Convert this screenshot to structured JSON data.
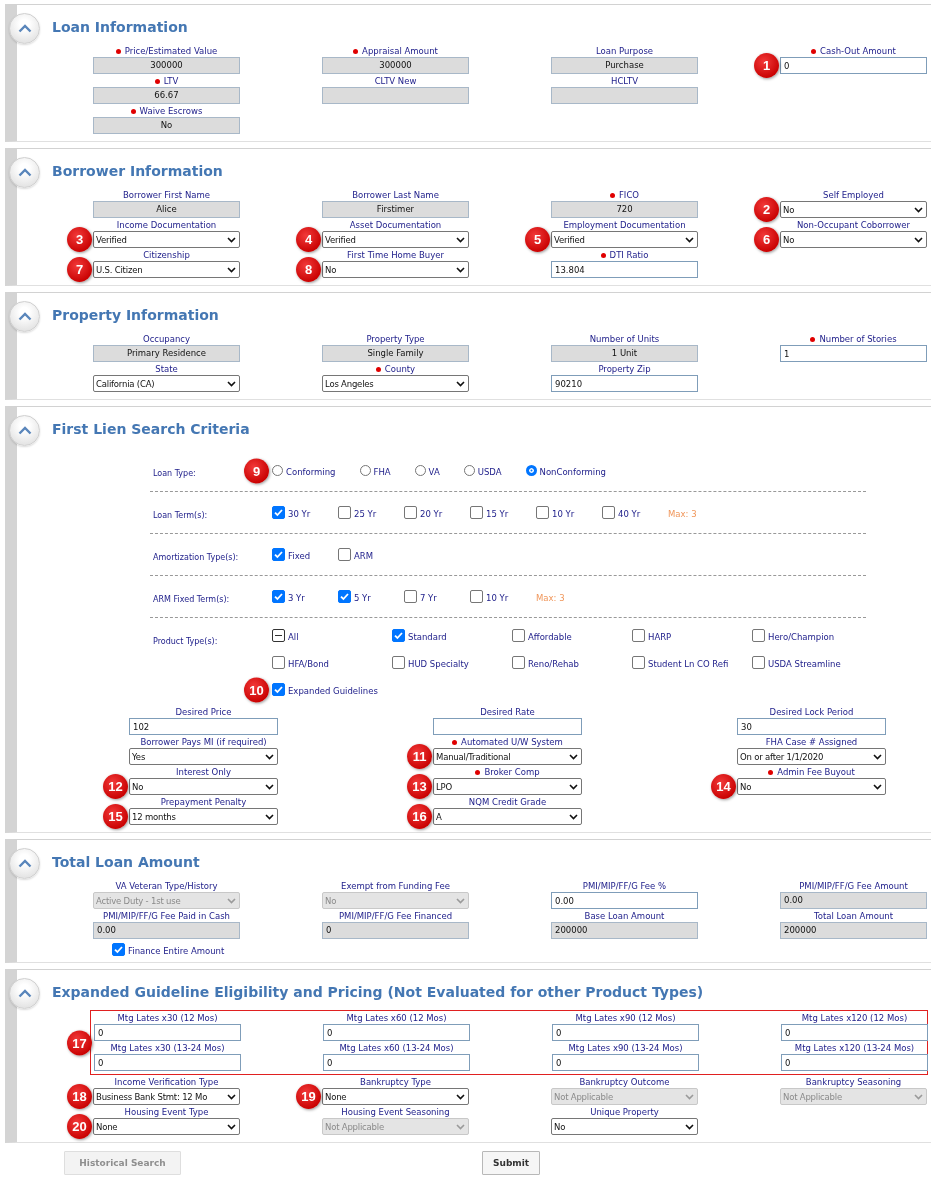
{
  "sections": [
    {
      "title": "Loan Information",
      "kind": "fields",
      "rows": [
        [
          {
            "label": "Price/Estimated Value",
            "required": true,
            "kind": "display",
            "value": "300000"
          },
          {
            "label": "Appraisal Amount",
            "required": true,
            "kind": "display",
            "value": "300000"
          },
          {
            "label": "Loan Purpose",
            "required": false,
            "kind": "display",
            "value": "Purchase"
          },
          {
            "label": "Cash-Out Amount",
            "required": true,
            "kind": "input",
            "value": "0",
            "badge": "1"
          }
        ],
        [
          {
            "label": "LTV",
            "required": true,
            "kind": "display",
            "value": "66.67"
          },
          {
            "label": "CLTV New",
            "required": false,
            "kind": "display"
          },
          {
            "label": "HCLTV",
            "required": false,
            "kind": "display"
          }
        ],
        [
          {
            "label": "Waive Escrows",
            "required": true,
            "kind": "display",
            "value": "No"
          }
        ]
      ]
    },
    {
      "title": "Borrower Information",
      "kind": "fields",
      "rows": [
        [
          {
            "label": "Borrower First Name",
            "required": false,
            "kind": "display",
            "value": "Alice"
          },
          {
            "label": "Borrower Last Name",
            "required": false,
            "kind": "display",
            "value": "Firstimer"
          },
          {
            "label": "FICO",
            "required": true,
            "kind": "display",
            "value": "720"
          },
          {
            "label": "Self Employed",
            "required": false,
            "kind": "select",
            "value": "No",
            "badge": "2"
          }
        ],
        [
          {
            "label": "Income Documentation",
            "required": false,
            "kind": "select",
            "value": "Verified",
            "badge": "3"
          },
          {
            "label": "Asset Documentation",
            "required": false,
            "kind": "select",
            "value": "Verified",
            "badge": "4"
          },
          {
            "label": "Employment Documentation",
            "required": false,
            "kind": "select",
            "value": "Verified",
            "badge": "5"
          },
          {
            "label": "Non-Occupant Coborrower",
            "required": false,
            "kind": "select",
            "value": "No",
            "badge": "6"
          }
        ],
        [
          {
            "label": "Citizenship",
            "required": false,
            "kind": "select",
            "value": "U.S. Citizen",
            "badge": "7"
          },
          {
            "label": "First Time Home Buyer",
            "required": false,
            "kind": "select",
            "value": "No",
            "badge": "8"
          },
          {
            "label": "DTI Ratio",
            "required": true,
            "kind": "input",
            "value": "13.804"
          }
        ]
      ]
    },
    {
      "title": "Property Information",
      "kind": "fields",
      "rows": [
        [
          {
            "label": "Occupancy",
            "required": false,
            "kind": "display",
            "value": "Primary Residence"
          },
          {
            "label": "Property Type",
            "required": false,
            "kind": "display",
            "value": "Single Family"
          },
          {
            "label": "Number of Units",
            "required": false,
            "kind": "display",
            "value": "1 Unit"
          },
          {
            "label": "Number of Stories",
            "required": true,
            "kind": "input",
            "value": "1"
          }
        ],
        [
          {
            "label": "State",
            "required": false,
            "kind": "select",
            "value": "California (CA)"
          },
          {
            "label": "County",
            "required": true,
            "kind": "select",
            "value": "Los Angeles"
          },
          {
            "label": "Property Zip",
            "required": false,
            "kind": "input",
            "value": "90210"
          }
        ]
      ]
    },
    {
      "title": "First Lien Search Criteria",
      "kind": "criteria",
      "criteria": [
        {
          "label": "Loan Type:",
          "kind": "radio",
          "options": [
            {
              "label": "Conforming",
              "selected": false,
              "badge": "9"
            },
            {
              "label": "FHA",
              "selected": false
            },
            {
              "label": "VA",
              "selected": false
            },
            {
              "label": "USDA",
              "selected": false
            },
            {
              "label": "NonConforming",
              "selected": true
            }
          ]
        },
        {
          "label": "Loan Term(s):",
          "kind": "checkbox",
          "max_note": "Max: 3",
          "options": [
            {
              "label": "30 Yr",
              "checked": true
            },
            {
              "label": "25 Yr",
              "checked": false
            },
            {
              "label": "20 Yr",
              "checked": false
            },
            {
              "label": "15 Yr",
              "checked": false
            },
            {
              "label": "10 Yr",
              "checked": false
            },
            {
              "label": "40 Yr",
              "checked": false
            }
          ]
        },
        {
          "label": "Amortization Type(s):",
          "kind": "checkbox",
          "options": [
            {
              "label": "Fixed",
              "checked": true
            },
            {
              "label": "ARM",
              "checked": false
            }
          ]
        },
        {
          "label": "ARM Fixed Term(s):",
          "kind": "checkbox",
          "max_note": "Max: 3",
          "options": [
            {
              "label": "3 Yr",
              "checked": true
            },
            {
              "label": "5 Yr",
              "checked": true
            },
            {
              "label": "7 Yr",
              "checked": false
            },
            {
              "label": "10 Yr",
              "checked": false
            }
          ]
        },
        {
          "label": "Product Type(s):",
          "kind": "checkbox_grid",
          "options": [
            {
              "label": "All",
              "checked": false,
              "indeterminate": true
            },
            {
              "label": "Standard",
              "checked": true,
              "indeterminate": false
            },
            {
              "label": "Affordable",
              "checked": false,
              "indeterminate": false
            },
            {
              "label": "HARP",
              "checked": false,
              "indeterminate": false
            },
            {
              "label": "Hero/Champion",
              "checked": false,
              "indeterminate": false
            },
            {
              "label": "HFA/Bond",
              "checked": false,
              "indeterminate": false
            },
            {
              "label": "HUD Specialty",
              "checked": false,
              "indeterminate": false
            },
            {
              "label": "Reno/Rehab",
              "checked": false,
              "indeterminate": false
            },
            {
              "label": "Student Ln CO Refi",
              "checked": false,
              "indeterminate": false
            },
            {
              "label": "USDA Streamline",
              "checked": false,
              "indeterminate": false
            },
            {
              "label": "Expanded Guidelines",
              "checked": true,
              "indeterminate": false,
              "badge": "10"
            }
          ]
        }
      ],
      "rows": [
        [
          {
            "label": "Desired Price",
            "required": false,
            "kind": "input",
            "value": "102"
          },
          {
            "label": "Desired Rate",
            "required": false,
            "kind": "input"
          },
          {
            "label": "Desired Lock Period",
            "required": false,
            "kind": "input",
            "value": "30"
          }
        ],
        [
          {
            "label": "Borrower Pays MI (if required)",
            "required": false,
            "kind": "select",
            "value": "Yes"
          },
          {
            "label": "Automated U/W System",
            "required": true,
            "kind": "select",
            "value": "Manual/Traditional",
            "badge": "11"
          },
          {
            "label": "FHA Case # Assigned",
            "required": false,
            "kind": "select",
            "value": "On or after 1/1/2020"
          }
        ],
        [
          {
            "label": "Interest Only",
            "required": false,
            "kind": "select",
            "value": "No",
            "badge": "12"
          },
          {
            "label": "Broker Comp",
            "required": true,
            "kind": "select",
            "value": "LPO",
            "badge": "13"
          },
          {
            "label": "Admin Fee Buyout",
            "required": true,
            "kind": "select",
            "value": "No",
            "badge": "14"
          }
        ],
        [
          {
            "label": "Prepayment Penalty",
            "required": false,
            "kind": "select",
            "value": "12 months",
            "badge": "15"
          },
          {
            "label": "NQM Credit Grade",
            "required": false,
            "kind": "select",
            "value": "A",
            "badge": "16"
          }
        ]
      ]
    },
    {
      "title": "Total Loan Amount",
      "kind": "fields",
      "rows": [
        [
          {
            "label": "VA Veteran Type/History",
            "required": false,
            "kind": "select_disabled",
            "value": "Active Duty - 1st use"
          },
          {
            "label": "Exempt from Funding Fee",
            "required": false,
            "kind": "select_disabled",
            "value": "No"
          },
          {
            "label": "PMI/MIP/FF/G Fee %",
            "required": false,
            "kind": "input",
            "value": "0.00"
          },
          {
            "label": "PMI/MIP/FF/G Fee Amount",
            "required": false,
            "kind": "readonly",
            "value": "0.00"
          }
        ],
        [
          {
            "label": "PMI/MIP/FF/G Fee Paid in Cash",
            "required": false,
            "kind": "readonly",
            "value": "0.00"
          },
          {
            "label": "PMI/MIP/FF/G Fee Financed",
            "required": false,
            "kind": "readonly",
            "value": "0"
          },
          {
            "label": "Base Loan Amount",
            "required": false,
            "kind": "readonly",
            "value": "200000"
          },
          {
            "label": "Total Loan Amount",
            "required": false,
            "kind": "readonly",
            "value": "200000"
          }
        ]
      ],
      "checkbox": {
        "label": "Finance Entire Amount",
        "checked": true
      }
    },
    {
      "title": "Expanded Guideline Eligibility and Pricing (Not Evaluated for other Product Types)",
      "kind": "fields",
      "highlight": {
        "badge": "17",
        "rows": [
          [
            {
              "label": "Mtg Lates x30 (12 Mos)",
              "required": false,
              "kind": "input",
              "value": "0"
            },
            {
              "label": "Mtg Lates x60 (12 Mos)",
              "required": false,
              "kind": "input",
              "value": "0"
            },
            {
              "label": "Mtg Lates x90 (12 Mos)",
              "required": false,
              "kind": "input",
              "value": "0"
            },
            {
              "label": "Mtg Lates x120 (12 Mos)",
              "required": false,
              "kind": "input",
              "value": "0"
            }
          ],
          [
            {
              "label": "Mtg Lates x30 (13-24 Mos)",
              "required": false,
              "kind": "input",
              "value": "0"
            },
            {
              "label": "Mtg Lates x60 (13-24 Mos)",
              "required": false,
              "kind": "input",
              "value": "0"
            },
            {
              "label": "Mtg Lates x90 (13-24 Mos)",
              "required": false,
              "kind": "input",
              "value": "0"
            },
            {
              "label": "Mtg Lates x120 (13-24 Mos)",
              "required": false,
              "kind": "input",
              "value": "0"
            }
          ]
        ]
      },
      "rows": [
        [
          {
            "label": "Income Verification Type",
            "required": false,
            "kind": "select",
            "value": "Business Bank Stmt: 12 Mo",
            "badge": "18"
          },
          {
            "label": "Bankruptcy Type",
            "required": false,
            "kind": "select",
            "value": "None",
            "badge": "19"
          },
          {
            "label": "Bankruptcy Outcome",
            "required": false,
            "kind": "select_disabled",
            "value": "Not Applicable"
          },
          {
            "label": "Bankruptcy Seasoning",
            "required": false,
            "kind": "select_disabled",
            "value": "Not Applicable"
          }
        ],
        [
          {
            "label": "Housing Event Type",
            "required": false,
            "kind": "select",
            "value": "None",
            "badge": "20"
          },
          {
            "label": "Housing Event Seasoning",
            "required": false,
            "kind": "select_disabled",
            "value": "Not Applicable"
          },
          {
            "label": "Unique Property",
            "required": false,
            "kind": "select",
            "value": "No"
          }
        ]
      ]
    }
  ],
  "footer_buttons": [
    {
      "label": "Historical Search",
      "disabled": true
    },
    {
      "label": "Submit",
      "disabled": false
    }
  ]
}
